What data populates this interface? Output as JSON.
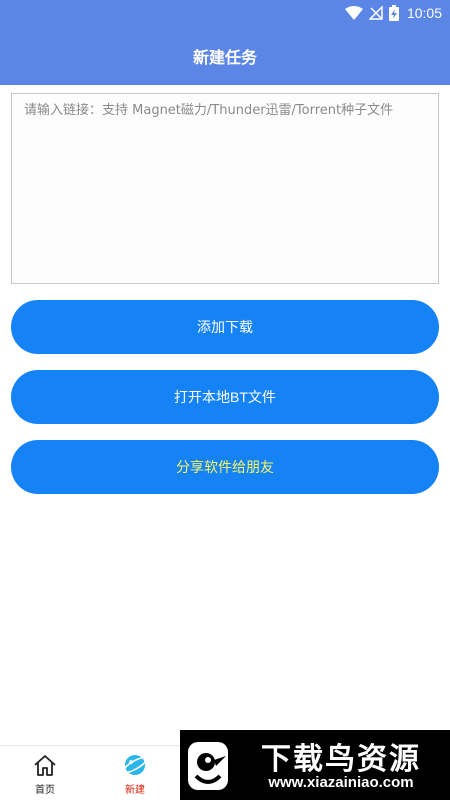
{
  "status_bar": {
    "time": "10:05",
    "icons": [
      "wifi-icon",
      "no-signal-icon",
      "battery-charging-icon"
    ]
  },
  "header": {
    "title": "新建任务",
    "color": "#5b86e5"
  },
  "link_input": {
    "value": "",
    "placeholder": "请输入链接：支持 Magnet磁力/Thunder迅雷/Torrent种子文件"
  },
  "actions": {
    "add_download": "添加下载",
    "open_local_bt": "打开本地BT文件",
    "share_app": "分享软件给朋友",
    "button_color": "#1583f5",
    "share_text_color": "#f5f569"
  },
  "bottom_nav": {
    "items": [
      {
        "label": "首页",
        "icon": "home-icon",
        "active": false
      },
      {
        "label": "新建",
        "icon": "planet-icon",
        "active": true
      }
    ],
    "active_color": "#d81e06"
  },
  "watermark": {
    "title": "下载鸟资源",
    "url": "www.xiazainiao.com"
  }
}
